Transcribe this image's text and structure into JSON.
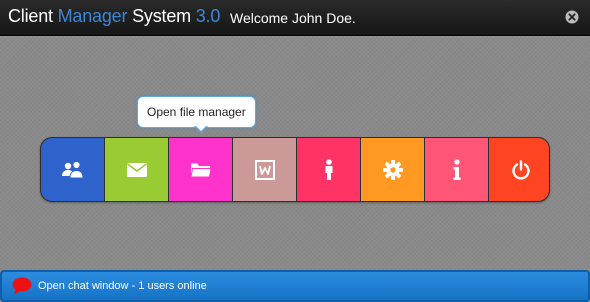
{
  "header": {
    "title_part1": "Client",
    "title_part2": "Manager",
    "title_part3": "System",
    "title_part4": "3.0",
    "welcome": "Welcome John Doe.",
    "close_icon": "close-icon"
  },
  "tooltip": {
    "text": "Open file manager"
  },
  "dock": {
    "items": [
      {
        "name": "clients",
        "icon": "users-icon",
        "color": "#2e63cc"
      },
      {
        "name": "messages",
        "icon": "envelope-icon",
        "color": "#99cc33"
      },
      {
        "name": "file-manager",
        "icon": "folder-icon",
        "color": "#ff33cc"
      },
      {
        "name": "documents",
        "icon": "word-document-icon",
        "color": "#cc9999"
      },
      {
        "name": "profile",
        "icon": "person-icon",
        "color": "#ff3366"
      },
      {
        "name": "settings",
        "icon": "gear-icon",
        "color": "#ff9922"
      },
      {
        "name": "info",
        "icon": "info-icon",
        "color": "#ff5577"
      },
      {
        "name": "logout",
        "icon": "power-icon",
        "color": "#ff4422"
      }
    ]
  },
  "chat": {
    "text": "Open chat window - 1 users online",
    "icon": "chat-bubble-icon",
    "icon_color": "#ee1111"
  }
}
